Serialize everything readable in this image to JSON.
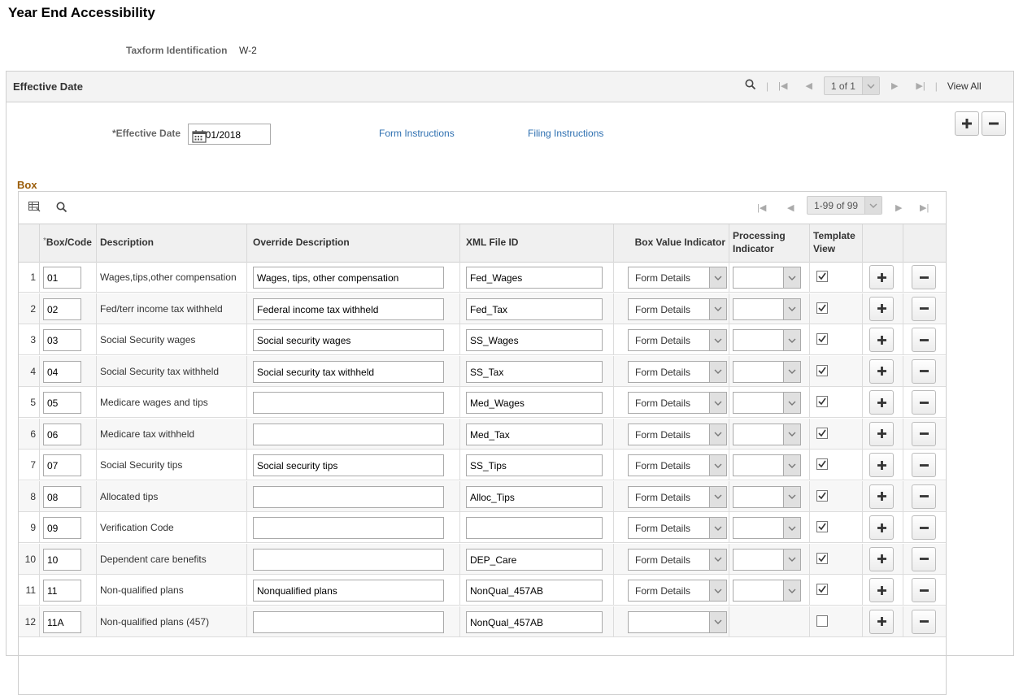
{
  "page": {
    "title": "Year End Accessibility"
  },
  "taxform": {
    "label": "Taxform Identification",
    "value": "W-2"
  },
  "effective_date": {
    "section_title": "Effective Date",
    "pager_text": "1 of 1",
    "view_all": "View All",
    "field_label": "*Effective Date",
    "field_value": "01/01/2018",
    "link_form": "Form Instructions",
    "link_filing": "Filing Instructions"
  },
  "box": {
    "title": "Box",
    "pager_text": "1-99 of 99",
    "columns": {
      "required_mark": "*",
      "box_code": "Box/Code",
      "description": "Description",
      "override": "Override Description",
      "xml": "XML File ID",
      "box_value": "Box Value Indicator",
      "processing_1": "Processing",
      "processing_2": "Indicator",
      "template_1": "Template",
      "template_2": "View"
    },
    "rows": [
      {
        "num": "1",
        "code": "01",
        "desc": "Wages,tips,other compensation",
        "override": "Wages, tips, other compensation",
        "xml": "Fed_Wages",
        "bvi": "Form Details",
        "checked": true
      },
      {
        "num": "2",
        "code": "02",
        "desc": "Fed/terr income tax withheld",
        "override": "Federal income tax withheld",
        "xml": "Fed_Tax",
        "bvi": "Form Details",
        "checked": true
      },
      {
        "num": "3",
        "code": "03",
        "desc": "Social Security wages",
        "override": "Social security wages",
        "xml": "SS_Wages",
        "bvi": "Form Details",
        "checked": true
      },
      {
        "num": "4",
        "code": "04",
        "desc": "Social Security tax withheld",
        "override": "Social security tax withheld",
        "xml": "SS_Tax",
        "bvi": "Form Details",
        "checked": true
      },
      {
        "num": "5",
        "code": "05",
        "desc": "Medicare wages and tips",
        "override": "",
        "xml": "Med_Wages",
        "bvi": "Form Details",
        "checked": true
      },
      {
        "num": "6",
        "code": "06",
        "desc": "Medicare tax withheld",
        "override": "",
        "xml": "Med_Tax",
        "bvi": "Form Details",
        "checked": true
      },
      {
        "num": "7",
        "code": "07",
        "desc": "Social Security tips",
        "override": "Social security tips",
        "xml": "SS_Tips",
        "bvi": "Form Details",
        "checked": true
      },
      {
        "num": "8",
        "code": "08",
        "desc": "Allocated tips",
        "override": "",
        "xml": "Alloc_Tips",
        "bvi": "Form Details",
        "checked": true
      },
      {
        "num": "9",
        "code": "09",
        "desc": "Verification Code",
        "override": "",
        "xml": "",
        "bvi": "Form Details",
        "checked": true
      },
      {
        "num": "10",
        "code": "10",
        "desc": "Dependent care benefits",
        "override": "",
        "xml": "DEP_Care",
        "bvi": "Form Details",
        "checked": true
      },
      {
        "num": "11",
        "code": "11",
        "desc": "Non-qualified plans",
        "override": "Nonqualified plans",
        "xml": "NonQual_457AB",
        "bvi": "Form Details",
        "checked": true
      },
      {
        "num": "12",
        "code": "11A",
        "desc": "Non-qualified plans (457)",
        "override": "",
        "xml": "NonQual_457AB",
        "bvi": "",
        "checked": false
      }
    ]
  }
}
